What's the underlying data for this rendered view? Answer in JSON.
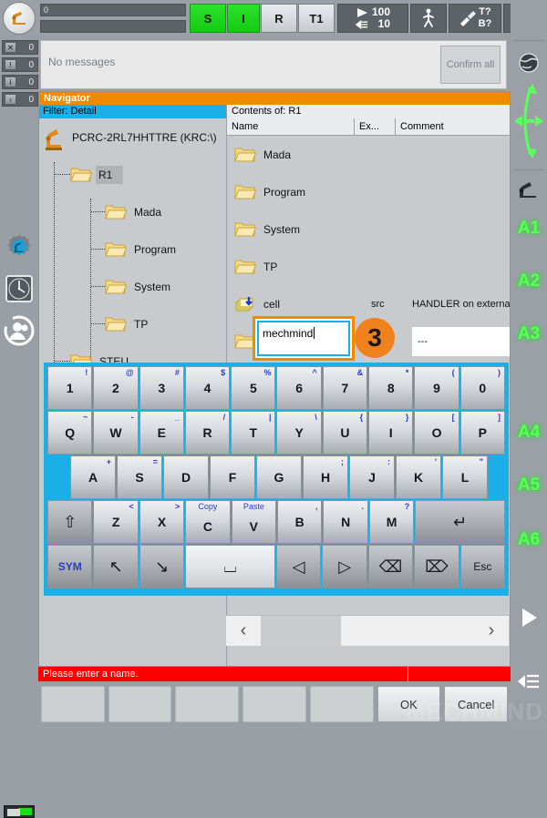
{
  "topbar": {
    "state_value": "0",
    "buttons": [
      {
        "label": "S",
        "name": "status-s",
        "style": "green"
      },
      {
        "label": "I",
        "name": "status-i",
        "style": "green"
      },
      {
        "label": "R",
        "name": "status-r",
        "style": "light"
      },
      {
        "label": "T1",
        "name": "operating-mode-t1",
        "style": "light"
      }
    ],
    "program_override": "100",
    "jog_override": "10",
    "tool_label": "T?",
    "base_label": "B?",
    "infinity": "∞",
    "icons": {
      "run": "play-icon",
      "hand": "hand-icon",
      "walk": "walking-person-icon",
      "tool": "tool-icon",
      "skip": "skip-forward-icon"
    }
  },
  "messages": {
    "text": "No messages",
    "confirm_all": "Confirm all",
    "counters": [
      {
        "icon": "error-icon",
        "glyph": "✕",
        "count": "0"
      },
      {
        "icon": "warning-icon",
        "glyph": "!",
        "count": "0"
      },
      {
        "icon": "info-icon",
        "glyph": "i",
        "count": "0"
      },
      {
        "icon": "wait-icon",
        "glyph": "‹",
        "count": "0"
      }
    ]
  },
  "navigator": {
    "title": "Navigator",
    "filter": "Filter: Detail",
    "contents_of": "Contents of: R1",
    "tree": [
      {
        "label": "PCRC-2RL7HHTTRE (KRC:\\)",
        "icon": "robot-icon",
        "indent": 0,
        "selected": false
      },
      {
        "label": "R1",
        "icon": "folder-icon",
        "indent": 1,
        "selected": true
      },
      {
        "label": "Mada",
        "icon": "folder-icon",
        "indent": 2,
        "selected": false
      },
      {
        "label": "Program",
        "icon": "folder-icon",
        "indent": 2,
        "selected": false
      },
      {
        "label": "System",
        "icon": "folder-icon",
        "indent": 2,
        "selected": false
      },
      {
        "label": "TP",
        "icon": "folder-icon",
        "indent": 2,
        "selected": false
      },
      {
        "label": "STEU",
        "icon": "folder-icon",
        "indent": 1,
        "selected": false
      }
    ],
    "columns": {
      "name": "Name",
      "ext": "Ex...",
      "comment": "Comment"
    },
    "rows": [
      {
        "name": "Mada",
        "ext": "",
        "comment": "",
        "icon": "folder-icon"
      },
      {
        "name": "Program",
        "ext": "",
        "comment": "",
        "icon": "folder-icon"
      },
      {
        "name": "System",
        "ext": "",
        "comment": "",
        "icon": "folder-icon"
      },
      {
        "name": "TP",
        "ext": "",
        "comment": "",
        "icon": "folder-icon"
      },
      {
        "name": "cell",
        "ext": "src",
        "comment": "HANDLER on external .",
        "icon": "src-file-icon"
      },
      {
        "name": "",
        "ext": "",
        "comment": "---",
        "icon": "folder-icon"
      }
    ],
    "scroll": {
      "left_arrow": "‹",
      "right_arrow": "›"
    }
  },
  "name_input": {
    "value": "mechmind",
    "placeholder": "",
    "callout_number": "3"
  },
  "keyboard": {
    "rows": [
      [
        {
          "main": "1",
          "alt": "!",
          "name": "key-1"
        },
        {
          "main": "2",
          "alt": "@",
          "name": "key-2"
        },
        {
          "main": "3",
          "alt": "#",
          "name": "key-3"
        },
        {
          "main": "4",
          "alt": "$",
          "name": "key-4"
        },
        {
          "main": "5",
          "alt": "%",
          "name": "key-5"
        },
        {
          "main": "6",
          "alt": "^",
          "name": "key-6"
        },
        {
          "main": "7",
          "alt": "&",
          "name": "key-7"
        },
        {
          "main": "8",
          "alt": "*",
          "name": "key-8"
        },
        {
          "main": "9",
          "alt": "(",
          "name": "key-9"
        },
        {
          "main": "0",
          "alt": ")",
          "name": "key-0"
        }
      ],
      [
        {
          "main": "Q",
          "alt": "~",
          "name": "key-q"
        },
        {
          "main": "W",
          "alt": "-",
          "name": "key-w"
        },
        {
          "main": "E",
          "alt": "_",
          "name": "key-e"
        },
        {
          "main": "R",
          "alt": "/",
          "name": "key-r"
        },
        {
          "main": "T",
          "alt": "|",
          "name": "key-t"
        },
        {
          "main": "Y",
          "alt": "\\",
          "name": "key-y"
        },
        {
          "main": "U",
          "alt": "{",
          "name": "key-u"
        },
        {
          "main": "I",
          "alt": "}",
          "name": "key-i"
        },
        {
          "main": "O",
          "alt": "[",
          "name": "key-o"
        },
        {
          "main": "P",
          "alt": "]",
          "name": "key-p"
        }
      ],
      [
        {
          "main": "A",
          "alt": "+",
          "name": "key-a"
        },
        {
          "main": "S",
          "alt": "=",
          "name": "key-s"
        },
        {
          "main": "D",
          "alt": "",
          "name": "key-d"
        },
        {
          "main": "F",
          "alt": "",
          "name": "key-f"
        },
        {
          "main": "G",
          "alt": "",
          "name": "key-g"
        },
        {
          "main": "H",
          "alt": ";",
          "name": "key-h"
        },
        {
          "main": "J",
          "alt": ":",
          "name": "key-j"
        },
        {
          "main": "K",
          "alt": "'",
          "name": "key-k"
        },
        {
          "main": "L",
          "alt": "\"",
          "name": "key-l"
        }
      ],
      [
        {
          "main": "⇧",
          "alt": "",
          "name": "key-shift",
          "style": "dark",
          "size": "big"
        },
        {
          "main": "Z",
          "alt": "<",
          "name": "key-z"
        },
        {
          "main": "X",
          "alt": ">",
          "name": "key-x"
        },
        {
          "main": "C",
          "alt": "Copy",
          "name": "key-c",
          "altwide": true
        },
        {
          "main": "V",
          "alt": "Paste",
          "name": "key-v",
          "altwide": true
        },
        {
          "main": "B",
          "alt": ",",
          "name": "key-b"
        },
        {
          "main": "N",
          "alt": ".",
          "name": "key-n"
        },
        {
          "main": "M",
          "alt": "?",
          "name": "key-m"
        },
        {
          "main": "↵",
          "alt": "",
          "name": "key-enter",
          "style": "dark",
          "size": "big"
        }
      ],
      [
        {
          "main": "SYM",
          "alt": "",
          "name": "key-sym",
          "style": "dark",
          "size": "sym"
        },
        {
          "main": "↖",
          "alt": "",
          "name": "key-home",
          "style": "dark",
          "size": "big"
        },
        {
          "main": "↘",
          "alt": "",
          "name": "key-end",
          "style": "dark",
          "size": "big"
        },
        {
          "main": "⌴",
          "alt": "",
          "name": "key-space",
          "style": "sp",
          "size": "big"
        },
        {
          "main": "◁",
          "alt": "",
          "name": "key-arrow-left",
          "style": "dark",
          "size": "big"
        },
        {
          "main": "▷",
          "alt": "",
          "name": "key-arrow-right",
          "style": "dark",
          "size": "big"
        },
        {
          "main": "⌫",
          "alt": "",
          "name": "key-backspace",
          "style": "dark",
          "size": "big"
        },
        {
          "main": "⌦",
          "alt": "",
          "name": "key-delete",
          "style": "dark",
          "size": "big"
        },
        {
          "main": "Esc",
          "alt": "",
          "name": "key-escape",
          "style": "dark",
          "size": "mid"
        }
      ]
    ]
  },
  "status": {
    "error_message": "Please enter a name."
  },
  "softkeys": [
    {
      "label": "",
      "name": "softkey-1"
    },
    {
      "label": "",
      "name": "softkey-2"
    },
    {
      "label": "",
      "name": "softkey-3"
    },
    {
      "label": "",
      "name": "softkey-4"
    },
    {
      "label": "",
      "name": "softkey-5"
    },
    {
      "label": "OK",
      "name": "softkey-ok"
    },
    {
      "label": "Cancel",
      "name": "softkey-cancel"
    }
  ],
  "rightbar": {
    "axes": [
      "A1",
      "A2",
      "A3",
      "A4",
      "A5",
      "A6"
    ],
    "icons": {
      "globe": "world-coordinate-icon",
      "jog": "jog-direction-icon",
      "robot": "robot-axis-icon",
      "play": "play-icon",
      "hand": "hand-icon"
    }
  },
  "colors": {
    "orange": "#f08a00",
    "cyan": "#1aafe6",
    "green": "#12cc12",
    "axis_green": "#5bff5b",
    "error_red": "#ff0000",
    "badge_orange": "#f0821e"
  },
  "watermark": "MECHMIND"
}
